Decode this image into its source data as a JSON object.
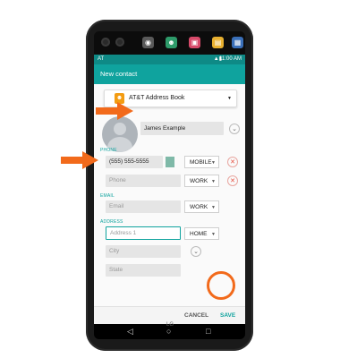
{
  "status_bar": {
    "time": "11:00 AM"
  },
  "top_icons": [
    "camera-app-icon",
    "contacts-app-icon",
    "gallery-app-icon",
    "notes-app-icon",
    "calendar-app-icon"
  ],
  "app_bar": {
    "title": "New contact"
  },
  "account": {
    "label": "AT&T Address Book"
  },
  "name": {
    "value": "James Example"
  },
  "phone_section": {
    "label": "PHONE"
  },
  "phones": [
    {
      "value": "(555) 555-5555",
      "placeholder": "",
      "type": "MOBILE"
    },
    {
      "value": "",
      "placeholder": "Phone",
      "type": "WORK"
    }
  ],
  "email_section": {
    "label": "EMAIL"
  },
  "email": {
    "placeholder": "Email",
    "type": "WORK"
  },
  "address_section": {
    "label": "ADDRESS"
  },
  "address": {
    "line1_placeholder": "Address 1",
    "type": "HOME",
    "city_placeholder": "City",
    "state_placeholder": "State"
  },
  "actions": {
    "cancel": "CANCEL",
    "save": "SAVE"
  },
  "brand": "LG",
  "colors": {
    "accent": "#0fa39e",
    "highlight": "#f26a1b",
    "remove": "#e74c3c"
  }
}
